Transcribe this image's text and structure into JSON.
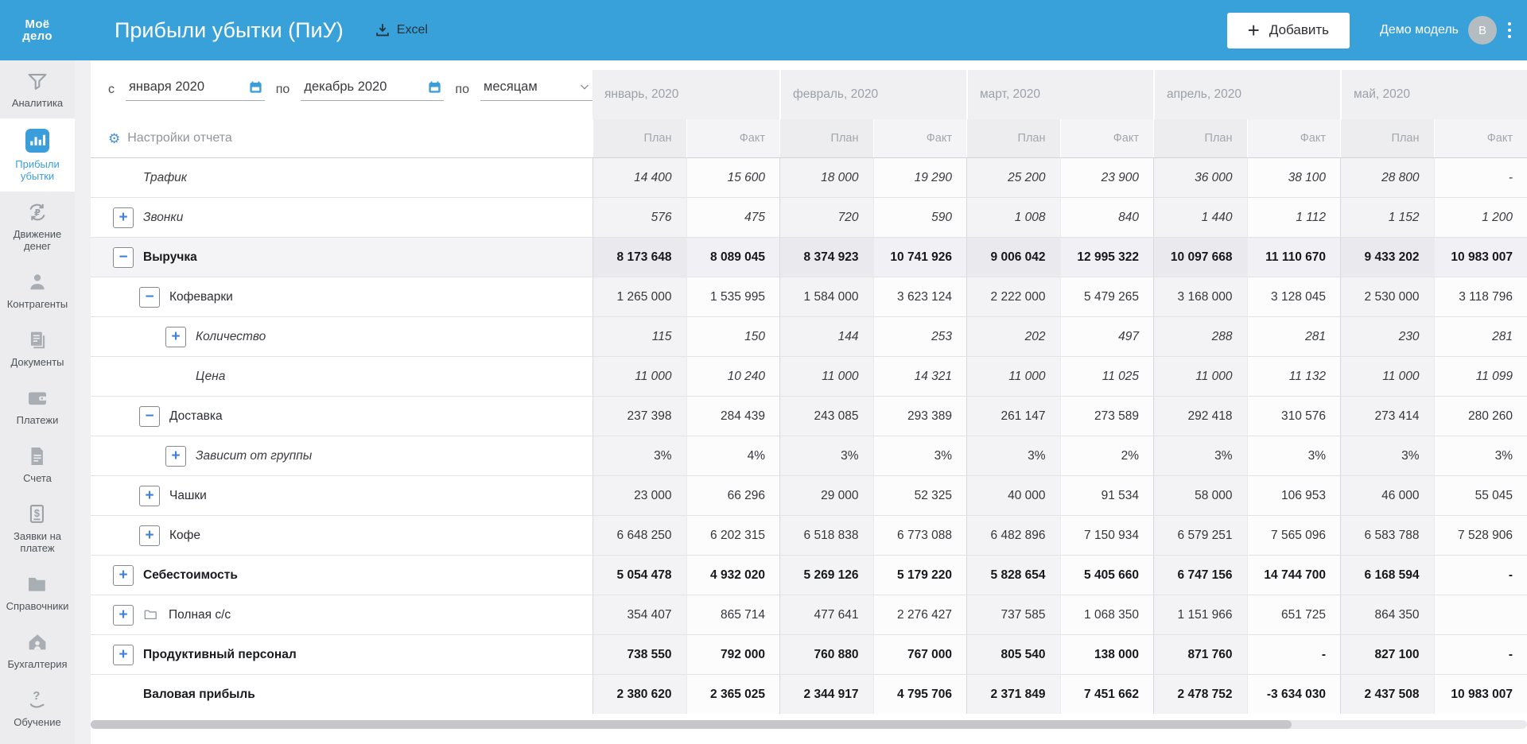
{
  "header": {
    "logo_line1": "Моё",
    "logo_line2": "дело",
    "title": "Прибыли убытки (ПиУ)",
    "excel_label": "Excel",
    "add_button": "Добавить",
    "account_label": "Демо модель",
    "avatar_letter": "B"
  },
  "sidebar": {
    "items": [
      {
        "label": "Аналитика",
        "icon": "analytics-icon",
        "active": false
      },
      {
        "label": "Прибыли убытки",
        "icon": "profit-loss-icon",
        "active": true
      },
      {
        "label": "Движение денег",
        "icon": "cashflow-icon",
        "active": false
      },
      {
        "label": "Контрагенты",
        "icon": "contractors-icon",
        "active": false
      },
      {
        "label": "Документы",
        "icon": "documents-icon",
        "active": false
      },
      {
        "label": "Платежи",
        "icon": "payments-icon",
        "active": false
      },
      {
        "label": "Счета",
        "icon": "invoices-icon",
        "active": false
      },
      {
        "label": "Заявки на платеж",
        "icon": "payment-requests-icon",
        "active": false
      },
      {
        "label": "Справочники",
        "icon": "directories-icon",
        "active": false
      },
      {
        "label": "Бухгалтерия",
        "icon": "accounting-icon",
        "active": false
      },
      {
        "label": "Обучение",
        "icon": "education-icon",
        "active": false,
        "bottom": true
      }
    ]
  },
  "filters": {
    "from_label": "с",
    "from_value": "января 2020",
    "to_label": "по",
    "to_value": "декабрь 2020",
    "period_label": "по",
    "period_value": "месяцам"
  },
  "report": {
    "settings_label": "Настройки отчета",
    "months": [
      "январь, 2020",
      "февраль, 2020",
      "март, 2020",
      "апрель, 2020",
      "май, 2020"
    ],
    "subcolumns": [
      "План",
      "Факт"
    ],
    "rows": [
      {
        "label": "Трафик",
        "level": 0,
        "expander": "",
        "italic_label": true,
        "italic_values": true,
        "bold": false,
        "shaded": false,
        "icon": "",
        "values": [
          "14 400",
          "15 600",
          "18 000",
          "19 290",
          "25 200",
          "23 900",
          "36 000",
          "38 100",
          "28 800",
          "-"
        ]
      },
      {
        "label": "Звонки",
        "level": 0,
        "expander": "plus",
        "italic_label": true,
        "italic_values": true,
        "bold": false,
        "shaded": false,
        "icon": "",
        "values": [
          "576",
          "475",
          "720",
          "590",
          "1 008",
          "840",
          "1 440",
          "1 112",
          "1 152",
          "1 200"
        ]
      },
      {
        "label": "Выручка",
        "level": 0,
        "expander": "minus",
        "italic_label": false,
        "italic_values": false,
        "bold": true,
        "shaded": true,
        "icon": "",
        "values": [
          "8 173 648",
          "8 089 045",
          "8 374 923",
          "10 741 926",
          "9 006 042",
          "12 995 322",
          "10 097 668",
          "11 110 670",
          "9 433 202",
          "10 983 007"
        ]
      },
      {
        "label": "Кофеварки",
        "level": 1,
        "expander": "minus",
        "italic_label": false,
        "italic_values": false,
        "bold": false,
        "shaded": false,
        "icon": "",
        "values": [
          "1 265 000",
          "1 535 995",
          "1 584 000",
          "3 623 124",
          "2 222 000",
          "5 479 265",
          "3 168 000",
          "3 128 045",
          "2 530 000",
          "3 118 796"
        ]
      },
      {
        "label": "Количество",
        "level": 2,
        "expander": "plus",
        "italic_label": true,
        "italic_values": true,
        "bold": false,
        "shaded": false,
        "icon": "",
        "values": [
          "115",
          "150",
          "144",
          "253",
          "202",
          "497",
          "288",
          "281",
          "230",
          "281"
        ]
      },
      {
        "label": "Цена",
        "level": 2,
        "expander": "",
        "italic_label": true,
        "italic_values": true,
        "bold": false,
        "shaded": false,
        "icon": "",
        "values": [
          "11 000",
          "10 240",
          "11 000",
          "14 321",
          "11 000",
          "11 025",
          "11 000",
          "11 132",
          "11 000",
          "11 099"
        ]
      },
      {
        "label": "Доставка",
        "level": 1,
        "expander": "minus",
        "italic_label": false,
        "italic_values": false,
        "bold": false,
        "shaded": false,
        "icon": "",
        "values": [
          "237 398",
          "284 439",
          "243 085",
          "293 389",
          "261 147",
          "273 589",
          "292 418",
          "310 576",
          "273 414",
          "280 260"
        ]
      },
      {
        "label": "Зависит от группы",
        "level": 2,
        "expander": "plus",
        "italic_label": true,
        "italic_values": false,
        "bold": false,
        "shaded": false,
        "icon": "",
        "values": [
          "3%",
          "4%",
          "3%",
          "3%",
          "3%",
          "2%",
          "3%",
          "3%",
          "3%",
          "3%"
        ]
      },
      {
        "label": "Чашки",
        "level": 1,
        "expander": "plus",
        "italic_label": false,
        "italic_values": false,
        "bold": false,
        "shaded": false,
        "icon": "",
        "values": [
          "23 000",
          "66 296",
          "29 000",
          "52 325",
          "40 000",
          "91 534",
          "58 000",
          "106 953",
          "46 000",
          "55 045"
        ]
      },
      {
        "label": "Кофе",
        "level": 1,
        "expander": "plus",
        "italic_label": false,
        "italic_values": false,
        "bold": false,
        "shaded": false,
        "icon": "",
        "values": [
          "6 648 250",
          "6 202 315",
          "6 518 838",
          "6 773 088",
          "6 482 896",
          "7 150 934",
          "6 579 251",
          "7 565 096",
          "6 583 788",
          "7 528 906"
        ]
      },
      {
        "label": "Себестоимость",
        "level": 0,
        "expander": "plus",
        "italic_label": false,
        "italic_values": false,
        "bold": true,
        "shaded": false,
        "icon": "",
        "values": [
          "5 054 478",
          "4 932 020",
          "5 269 126",
          "5 179 220",
          "5 828 654",
          "5 405 660",
          "6 747 156",
          "14 744 700",
          "6 168 594",
          "-"
        ]
      },
      {
        "label": "Полная с/с",
        "level": 0,
        "expander": "plus",
        "italic_label": false,
        "italic_values": false,
        "bold": false,
        "shaded": false,
        "icon": "folder",
        "values": [
          "354 407",
          "865 714",
          "477 641",
          "2 276 427",
          "737 585",
          "1 068 350",
          "1 151 966",
          "651 725",
          "864 350",
          ""
        ]
      },
      {
        "label": "Продуктивный персонал",
        "level": 0,
        "expander": "plus",
        "italic_label": false,
        "italic_values": false,
        "bold": true,
        "shaded": false,
        "icon": "",
        "values": [
          "738 550",
          "792 000",
          "760 880",
          "767 000",
          "805 540",
          "138 000",
          "871 760",
          "-",
          "827 100",
          "-"
        ]
      },
      {
        "label": "Валовая прибыль",
        "level": 0,
        "expander": "",
        "italic_label": false,
        "italic_values": false,
        "bold": true,
        "shaded": false,
        "icon": "",
        "values": [
          "2 380 620",
          "2 365 025",
          "2 344 917",
          "4 795 706",
          "2 371 849",
          "7 451 662",
          "2 478 752",
          "-3 634 030",
          "2 437 508",
          "10 983 007"
        ]
      }
    ]
  }
}
